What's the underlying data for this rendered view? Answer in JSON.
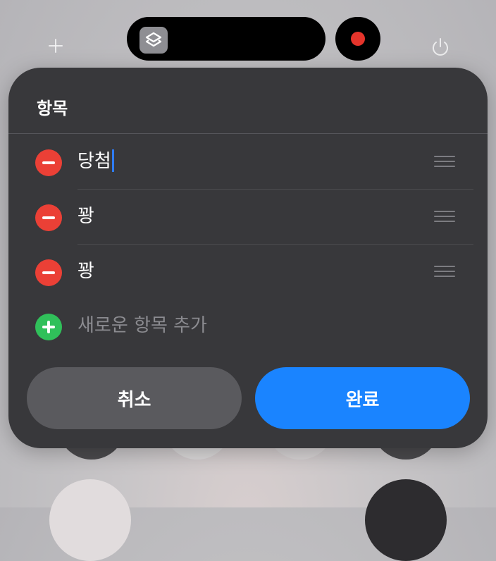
{
  "status_bar": {
    "add_icon": "plus-icon",
    "app_icon": "shortcuts-layers-icon",
    "record_indicator_color": "#e5342b",
    "power_icon": "power-icon"
  },
  "panel": {
    "title": "항목",
    "items": [
      {
        "label": "당첨",
        "editing": true
      },
      {
        "label": "꽝",
        "editing": false
      },
      {
        "label": "꽝",
        "editing": false
      }
    ],
    "add_placeholder": "새로운 항목 추가",
    "cancel_label": "취소",
    "done_label": "완료"
  },
  "colors": {
    "panel_bg": "#38383b",
    "delete": "#eb4036",
    "add": "#30c05a",
    "accent": "#1a84ff",
    "cancel_bg": "#5a5a5e"
  }
}
